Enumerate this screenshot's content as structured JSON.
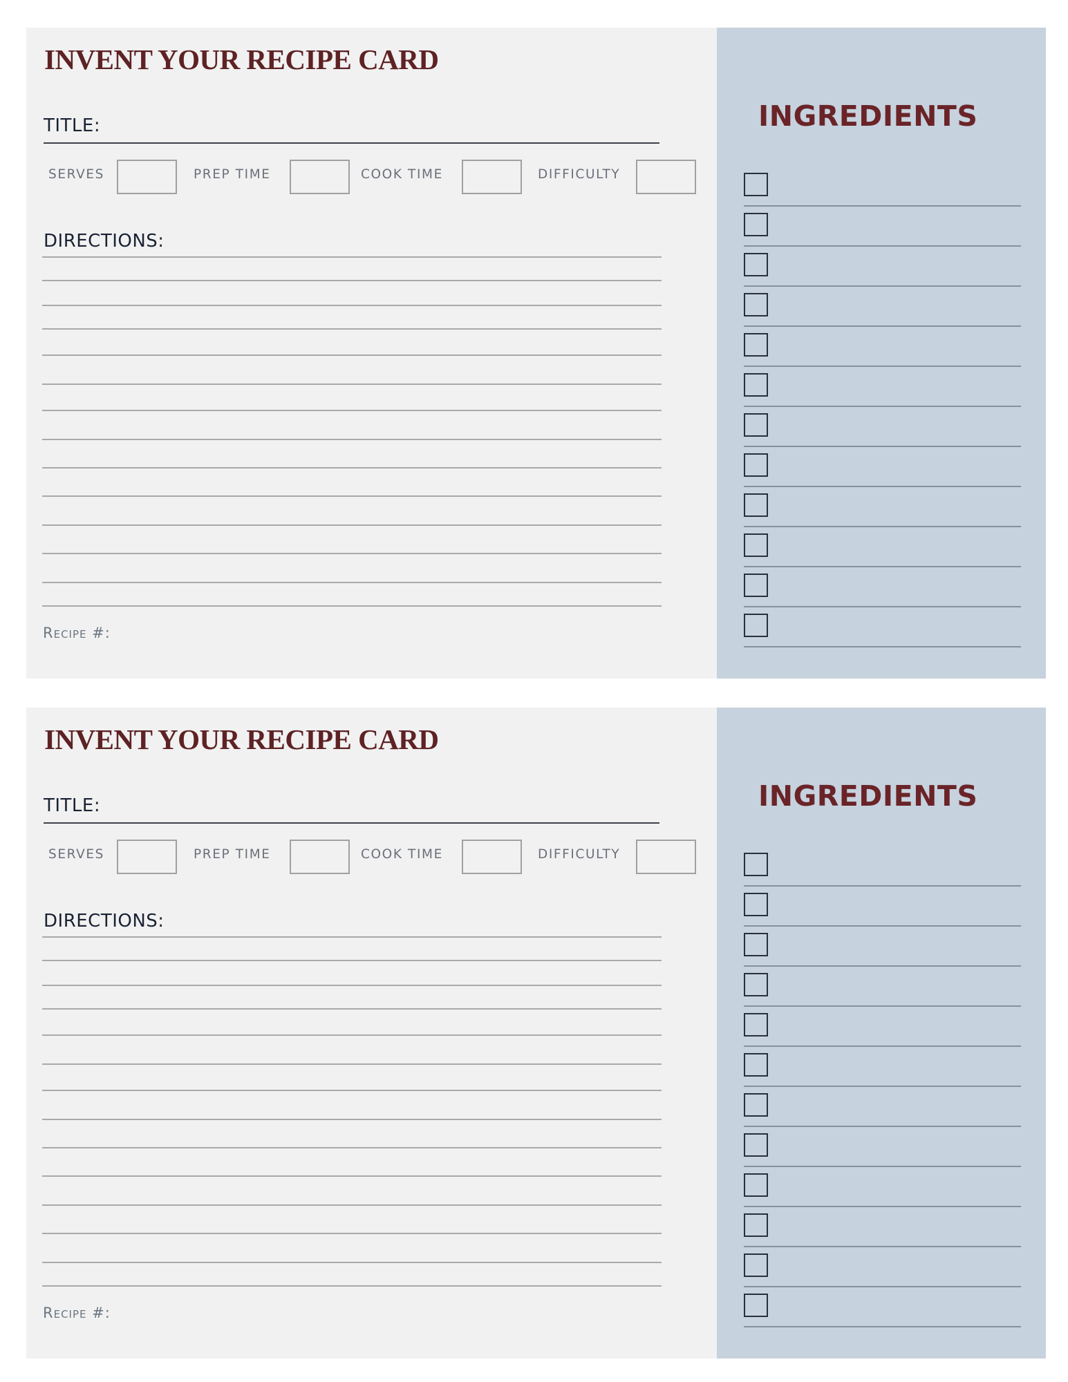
{
  "document": {
    "background_color": "#ffffff",
    "card_background": "#f1f1f1",
    "ingredients_panel_color": "#c6d2de",
    "accent_color": "#5e2224"
  },
  "cards": [
    {
      "heading": "INVENT YOUR RECIPE CARD",
      "title_label": "TITLE:",
      "title_value": "",
      "meta_fields": [
        {
          "label": "SERVES",
          "value": ""
        },
        {
          "label": "PREP TIME",
          "value": ""
        },
        {
          "label": "COOK TIME",
          "value": ""
        },
        {
          "label": "DIFFICULTY",
          "value": ""
        }
      ],
      "directions_label": "DIRECTIONS:",
      "direction_lines": [
        "",
        "",
        "",
        "",
        "",
        "",
        "",
        "",
        "",
        "",
        "",
        "",
        "",
        ""
      ],
      "recipe_number_label": "Recipe #:",
      "recipe_number_value": "",
      "ingredients_heading": "INGREDIENTS",
      "ingredients": [
        {
          "checked": false,
          "text": ""
        },
        {
          "checked": false,
          "text": ""
        },
        {
          "checked": false,
          "text": ""
        },
        {
          "checked": false,
          "text": ""
        },
        {
          "checked": false,
          "text": ""
        },
        {
          "checked": false,
          "text": ""
        },
        {
          "checked": false,
          "text": ""
        },
        {
          "checked": false,
          "text": ""
        },
        {
          "checked": false,
          "text": ""
        },
        {
          "checked": false,
          "text": ""
        },
        {
          "checked": false,
          "text": ""
        },
        {
          "checked": false,
          "text": ""
        }
      ]
    },
    {
      "heading": "INVENT YOUR RECIPE CARD",
      "title_label": "TITLE:",
      "title_value": "",
      "meta_fields": [
        {
          "label": "SERVES",
          "value": ""
        },
        {
          "label": "PREP TIME",
          "value": ""
        },
        {
          "label": "COOK TIME",
          "value": ""
        },
        {
          "label": "DIFFICULTY",
          "value": ""
        }
      ],
      "directions_label": "DIRECTIONS:",
      "direction_lines": [
        "",
        "",
        "",
        "",
        "",
        "",
        "",
        "",
        "",
        "",
        "",
        "",
        "",
        ""
      ],
      "recipe_number_label": "Recipe #:",
      "recipe_number_value": "",
      "ingredients_heading": "INGREDIENTS",
      "ingredients": [
        {
          "checked": false,
          "text": ""
        },
        {
          "checked": false,
          "text": ""
        },
        {
          "checked": false,
          "text": ""
        },
        {
          "checked": false,
          "text": ""
        },
        {
          "checked": false,
          "text": ""
        },
        {
          "checked": false,
          "text": ""
        },
        {
          "checked": false,
          "text": ""
        },
        {
          "checked": false,
          "text": ""
        },
        {
          "checked": false,
          "text": ""
        },
        {
          "checked": false,
          "text": ""
        },
        {
          "checked": false,
          "text": ""
        },
        {
          "checked": false,
          "text": ""
        }
      ]
    }
  ]
}
